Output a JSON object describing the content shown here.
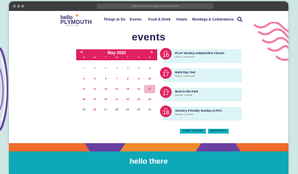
{
  "browser": {
    "url": "https://www.hello-plymouth.com/events"
  },
  "logo": {
    "line1": "hello",
    "line2": "PLYMOUTH",
    "tagline": "MICHIGAN"
  },
  "nav": {
    "items": [
      "Things to Do",
      "Events",
      "Food & Drink",
      "Hotels",
      "Meetings & Celebrations"
    ],
    "search_icon": "search-icon"
  },
  "page": {
    "heading": "events"
  },
  "calendar": {
    "month_label": "May 2025",
    "prev": "<",
    "next": ">",
    "weekdays": [
      "S",
      "M",
      "T",
      "W",
      "T",
      "F",
      "S"
    ],
    "weeks": [
      [
        "27",
        "28",
        "29",
        "30",
        "1",
        "2",
        "3"
      ],
      [
        "4",
        "5",
        "6",
        "7",
        "8",
        "9",
        "10"
      ],
      [
        "11",
        "12",
        "13",
        "14",
        "15",
        "16",
        "17"
      ],
      [
        "18",
        "19",
        "20",
        "21",
        "22",
        "23",
        "24"
      ],
      [
        "25",
        "26",
        "27",
        "28",
        "29",
        "30",
        "31"
      ]
    ],
    "selected_day": "17"
  },
  "events": [
    {
      "month": "MAY",
      "day": "16",
      "title": "PLAY Hockey Independent Classic",
      "time": "All Day • until May 18"
    },
    {
      "month": "MAY",
      "day": "17",
      "title": "Multi-Day Test",
      "time": "All Day • until May 20"
    },
    {
      "month": "MAY",
      "day": "17",
      "title": "Bark in the Park",
      "time": "9:00 AM - 1:00 PM"
    },
    {
      "month": "MAY",
      "day": "18",
      "title": "Sensory-Friendly Sunday at PCC",
      "time": "9:00 AM - 12:00 PM"
    }
  ],
  "actions": {
    "submit": "SUBMIT AN EVENT",
    "more": "MORE EVENTS"
  },
  "footer": {
    "title": "hello there"
  },
  "colors": {
    "accent": "#e0215f",
    "navy": "#1f1d4d",
    "teal": "#0fa8b8",
    "event_bg": "#ddf5f6"
  }
}
